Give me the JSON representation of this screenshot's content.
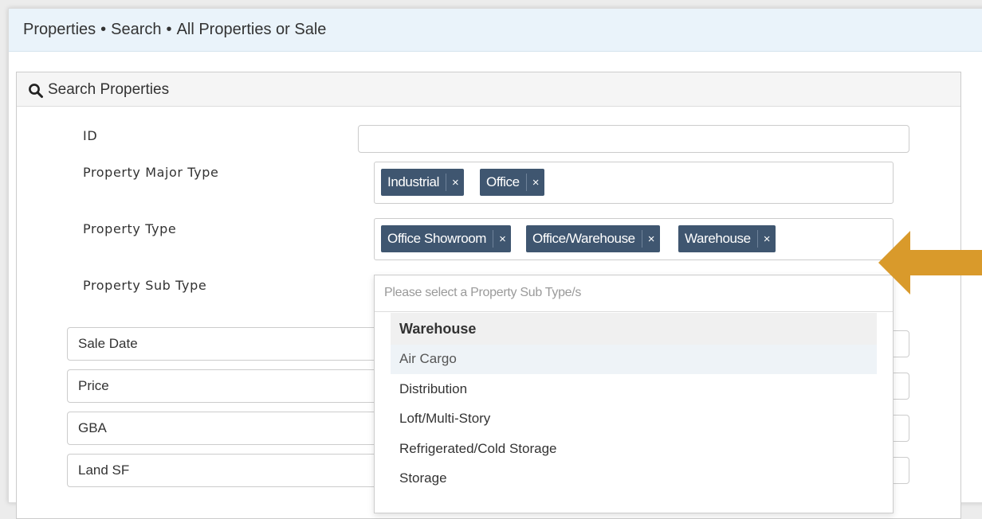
{
  "breadcrumb": {
    "items": [
      "Properties",
      "Search",
      "All Properties or Sale"
    ],
    "separator": "•"
  },
  "panel": {
    "title": "Search Properties",
    "icon": "search-icon"
  },
  "form": {
    "id_label": "ID",
    "id_value": "",
    "major_type_label": "Property Major Type",
    "major_type_tags": [
      "Industrial",
      "Office"
    ],
    "type_label": "Property Type",
    "type_tags": [
      "Office Showroom",
      "Office/Warehouse",
      "Warehouse"
    ],
    "sub_type_label": "Property Sub Type",
    "tag_remove_symbol": "×"
  },
  "dropdown": {
    "placeholder": "Please select a Property Sub Type/s",
    "group_label": "Warehouse",
    "options": [
      "Air Cargo",
      "Distribution",
      "Loft/Multi-Story",
      "Refrigerated/Cold Storage",
      "Storage"
    ],
    "highlighted_option": "Air Cargo"
  },
  "range_fields": [
    "Sale Date",
    "Price",
    "GBA",
    "Land SF"
  ],
  "colors": {
    "breadcrumb_bg": "#eaf3fa",
    "tag_bg": "#3f5670",
    "arrow": "#d99a2b"
  }
}
